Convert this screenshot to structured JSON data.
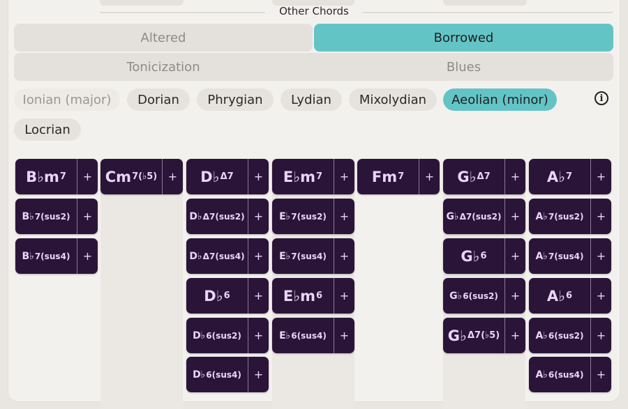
{
  "section": {
    "title": "Other Chords"
  },
  "tabs": [
    {
      "label": "Altered",
      "active": false
    },
    {
      "label": "Borrowed",
      "active": true
    },
    {
      "label": "Tonicization",
      "active": false
    },
    {
      "label": "Blues",
      "active": false
    }
  ],
  "modes": [
    {
      "label": "Ionian (major)",
      "state": "muted"
    },
    {
      "label": "Dorian",
      "state": "normal"
    },
    {
      "label": "Phrygian",
      "state": "normal"
    },
    {
      "label": "Lydian",
      "state": "normal"
    },
    {
      "label": "Mixolydian",
      "state": "normal"
    },
    {
      "label": "Aeolian (minor)",
      "state": "active"
    },
    {
      "label": "Locrian",
      "state": "normal"
    }
  ],
  "info_icon": "info-icon",
  "colors": {
    "accent": "#63c4c6",
    "chord_bg": "#2a1538",
    "chord_text": "#e9d6f5"
  },
  "add_label": "+",
  "chord_columns": [
    [
      {
        "root": "B♭m",
        "sup": "7",
        "size": "big"
      },
      {
        "root": "B♭",
        "sup": "7(sus2)",
        "size": "small"
      },
      {
        "root": "B♭",
        "sup": "7(sus4)",
        "size": "small"
      }
    ],
    [
      {
        "root": "Cm",
        "sup": "7(♭5)",
        "size": "big"
      }
    ],
    [
      {
        "root": "D♭",
        "sup": "Δ7",
        "size": "big"
      },
      {
        "root": "D♭",
        "sup": "Δ7(sus2)",
        "size": "small"
      },
      {
        "root": "D♭",
        "sup": "Δ7(sus4)",
        "size": "small"
      },
      {
        "root": "D♭",
        "sup": "6",
        "size": "big"
      },
      {
        "root": "D♭",
        "sup": "6(sus2)",
        "size": "small"
      },
      {
        "root": "D♭",
        "sup": "6(sus4)",
        "size": "small"
      }
    ],
    [
      {
        "root": "E♭m",
        "sup": "7",
        "size": "big"
      },
      {
        "root": "E♭",
        "sup": "7(sus2)",
        "size": "small"
      },
      {
        "root": "E♭",
        "sup": "7(sus4)",
        "size": "small"
      },
      {
        "root": "E♭m",
        "sup": "6",
        "size": "big"
      },
      {
        "root": "E♭",
        "sup": "6(sus4)",
        "size": "small"
      }
    ],
    [
      {
        "root": "Fm",
        "sup": "7",
        "size": "big"
      }
    ],
    [
      {
        "root": "G♭",
        "sup": "Δ7",
        "size": "big"
      },
      {
        "root": "G♭",
        "sup": "Δ7(sus2)",
        "size": "small"
      },
      {
        "root": "G♭",
        "sup": "6",
        "size": "big"
      },
      {
        "root": "G♭",
        "sup": "6(sus2)",
        "size": "small"
      },
      {
        "root": "G♭",
        "sup": "Δ7(♭5)",
        "size": "big"
      }
    ],
    [
      {
        "root": "A♭",
        "sup": "7",
        "size": "big"
      },
      {
        "root": "A♭",
        "sup": "7(sus2)",
        "size": "small"
      },
      {
        "root": "A♭",
        "sup": "7(sus4)",
        "size": "small"
      },
      {
        "root": "A♭",
        "sup": "6",
        "size": "big"
      },
      {
        "root": "A♭",
        "sup": "6(sus2)",
        "size": "small"
      },
      {
        "root": "A♭",
        "sup": "6(sus4)",
        "size": "small"
      }
    ]
  ]
}
